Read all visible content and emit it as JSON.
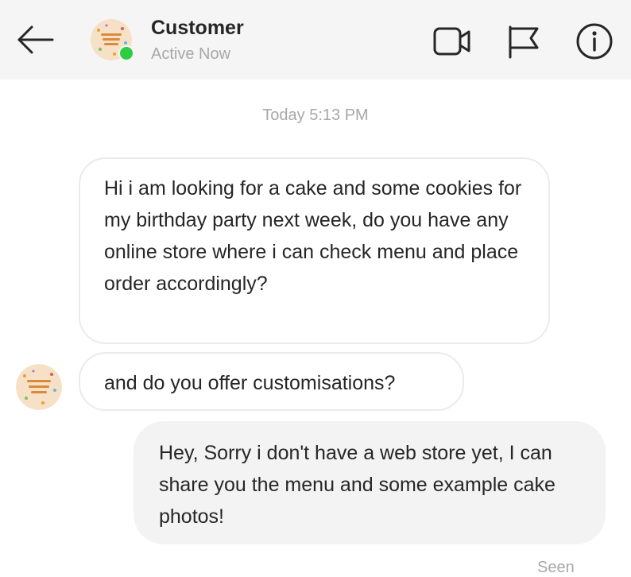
{
  "header": {
    "contact_name": "Customer",
    "status": "Active Now",
    "online_color": "#2ecc40",
    "icons": {
      "back": "arrow-left-icon",
      "video": "video-camera-icon",
      "flag": "flag-icon",
      "info": "info-icon"
    }
  },
  "conversation": {
    "timestamp": "Today 5:13 PM",
    "messages": [
      {
        "direction": "incoming",
        "text": "Hi i am looking for a cake and some cookies for my birthday party next week, do you have any online store where i can check menu and place order accordingly?"
      },
      {
        "direction": "incoming",
        "text": "and do you offer customisations?"
      },
      {
        "direction": "outgoing",
        "text": "Hey, Sorry i don't have a web store yet, I can share you the menu and some example cake photos!"
      }
    ],
    "read_receipt": "Seen"
  },
  "colors": {
    "header_bg": "#f5f5f5",
    "incoming_bubble_bg": "#ffffff",
    "incoming_bubble_border": "#ebebeb",
    "outgoing_bubble_bg": "#f3f3f3",
    "muted_text": "#a8a8a8",
    "avatar_bg": "#f6e0c6"
  }
}
